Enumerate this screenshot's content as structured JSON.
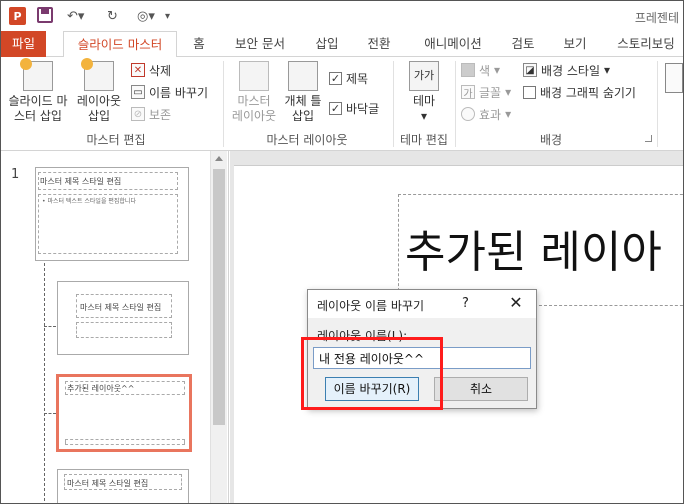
{
  "titlebar": {
    "app_icon": "P",
    "app_title": "프레젠테"
  },
  "tabs": [
    {
      "label": "파일"
    },
    {
      "label": "슬라이드 마스터"
    },
    {
      "label": "홈"
    },
    {
      "label": "보안 문서"
    },
    {
      "label": "삽입"
    },
    {
      "label": "전환"
    },
    {
      "label": "애니메이션"
    },
    {
      "label": "검토"
    },
    {
      "label": "보기"
    },
    {
      "label": "스토리보딩"
    }
  ],
  "ribbon": {
    "insert_master": {
      "line1": "슬라이드 마",
      "line2": "스터 삽입"
    },
    "insert_layout": {
      "line1": "레이아웃",
      "line2": "삽입"
    },
    "delete": "삭제",
    "rename": "이름 바꾸기",
    "preserve": "보존",
    "group_master_edit": "마스터 편집",
    "master_layout": {
      "line1": "마스터",
      "line2": "레이아웃"
    },
    "insert_placeholder": {
      "line1": "개체 틀",
      "line2": "삽입"
    },
    "title_check": "제목",
    "footer_check": "바닥글",
    "group_master_layout": "마스터 레이아웃",
    "theme_icon": "가가",
    "theme": "테마",
    "group_theme_edit": "테마 편집",
    "colors": "색",
    "fonts": "글꼴",
    "effects": "효과",
    "bg_styles": "배경 스타일",
    "hide_bg": "배경 그래픽 숨기기",
    "group_background": "배경"
  },
  "thumbnails": {
    "slide_number": "1",
    "master_title": "마스터 제목 스타일 편집",
    "master_text": "• 마스터 텍스트 스타일을 편집합니다",
    "layout1_title": "마스터 제목 스타일 편집",
    "layout2_title": "추가된 레이아웃^^",
    "layout3_title": "마스터 제목 스타일 편집"
  },
  "canvas": {
    "title_text": "추가된 레이아"
  },
  "dialog": {
    "title": "레이아웃 이름 바꾸기",
    "help": "?",
    "close": "✕",
    "label": "레이아웃 이름(L):",
    "input_value": "내 전용 레이아웃^^",
    "rename_button": "이름 바꾸기(R)",
    "cancel_button": "취소"
  },
  "colors": {
    "accent": "#d24726",
    "selection": "#e9755e",
    "highlight": "#ff1c1c"
  }
}
